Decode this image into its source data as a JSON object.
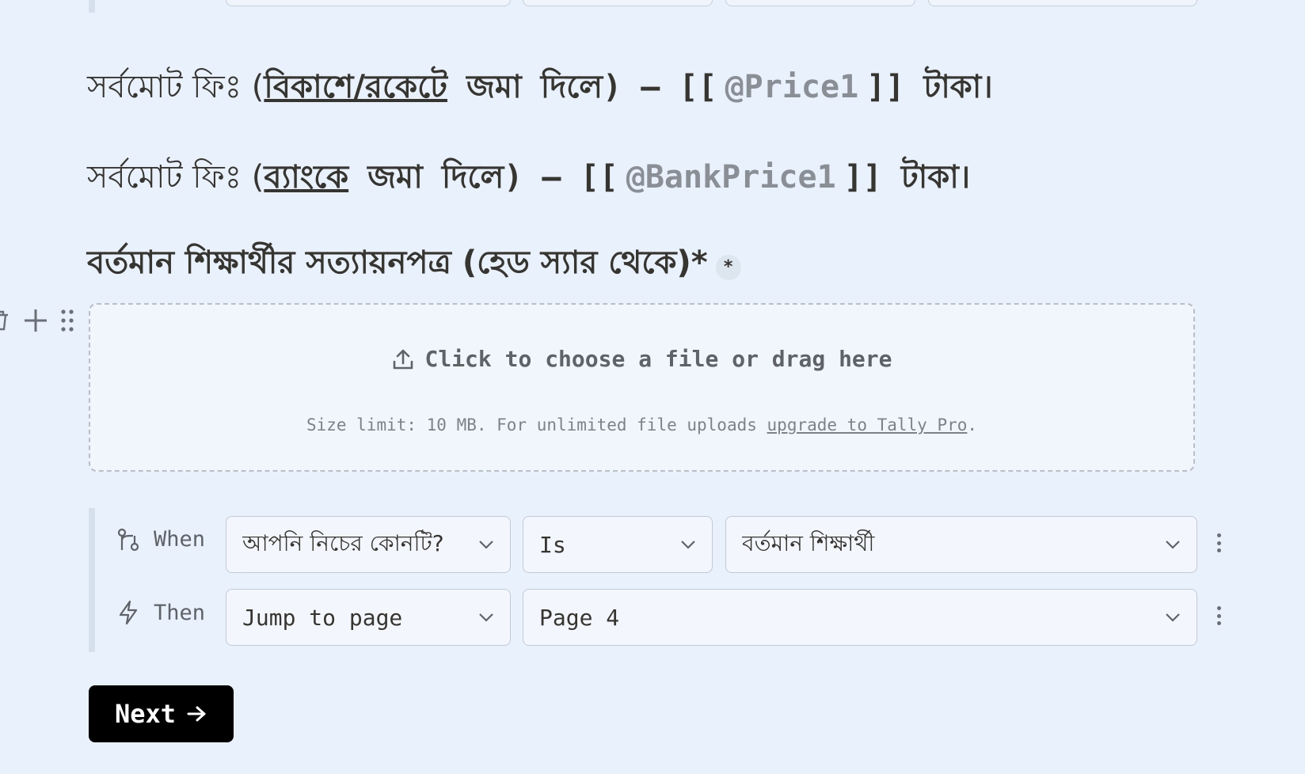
{
  "fees": {
    "bkash_prefix": "সর্বমোট ফিঃ (",
    "bkash_link": "বিকাশে/রকেটে",
    "bkash_suffix": " জমা দিলে) – [[",
    "bkash_var": "@Price1",
    "bkash_end": "]] টাকা।",
    "bank_prefix": "সর্বমোট ফিঃ (",
    "bank_link": "ব্যাংকে",
    "bank_suffix": " জমা দিলে) – [[",
    "bank_var": "@BankPrice1",
    "bank_end": "]] টাকা।"
  },
  "question": {
    "title": "বর্তমান শিক্ষার্থীর সত্যায়নপত্র (হেড স্যার থেকে)*",
    "required_mark": "*"
  },
  "upload": {
    "prompt": "Click to choose a file or drag here",
    "note": "Size limit: 10 MB. For unlimited file uploads ",
    "link": "upgrade to Tally Pro",
    "note_end": "."
  },
  "logic": {
    "when_label": "When",
    "then_label": "Then",
    "when_field": "আপনি নিচের কোনটি?",
    "operator": "Is",
    "value": "বর্তমান শিক্ষার্থী",
    "action": "Jump to page",
    "target": "Page 4"
  },
  "next_label": "Next"
}
